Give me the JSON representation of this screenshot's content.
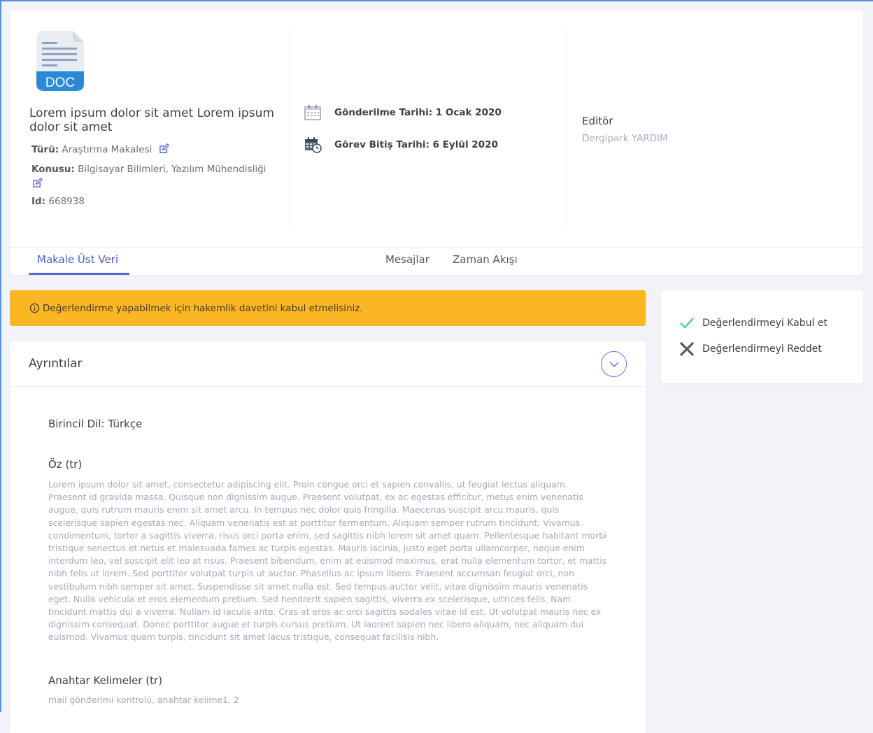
{
  "article": {
    "doc_icon_label": "DOC",
    "title": "Lorem ipsum dolor sit amet Lorem ipsum dolor sit amet",
    "type_label": "Türü:",
    "type_value": "Araştırma Makalesi",
    "subject_label": "Konusu:",
    "subject_value": "Bilgisayar Bilimleri, Yazılım Mühendisliği",
    "id_label": "Id:",
    "id_value": "668938"
  },
  "dates": {
    "submitted": "Gönderilme Tarihi: 1 Ocak 2020",
    "deadline": "Görev Bitiş Tarihi: 6 Eylül 2020"
  },
  "editor": {
    "label": "Editör",
    "name": "Dergipark YARDIM"
  },
  "tabs": [
    {
      "label": "Makale Üst Veri",
      "active": true
    },
    {
      "label": "Mesajlar",
      "active": false
    },
    {
      "label": "Zaman Akışı",
      "active": false
    }
  ],
  "warning": {
    "text": "Değerlendirme yapabilmek için hakemlik davetini kabul etmelisiniz."
  },
  "actions": {
    "accept": "Değerlendirmeyi Kabul et",
    "reject": "Değerlendirmeyi Reddet"
  },
  "details": {
    "title": "Ayrıntılar",
    "primary_language": "Birincil Dil: Türkçe",
    "abstract_heading": "Öz (tr)",
    "abstract_text": "Lorem ipsum dolor sit amet, consectetur adipiscing elit. Proin congue orci et sapien convallis, ut feugiat lectus aliquam. Praesent id gravida massa. Quisque non dignissim augue. Praesent volutpat, ex ac egestas efficitur, metus enim venenatis augue, quis rutrum mauris enim sit amet arcu. In tempus nec dolor quis fringilla. Maecenas suscipit arcu mauris, quis scelerisque sapien egestas nec. Aliquam venenatis est at porttitor fermentum. Aliquam semper rutrum tincidunt. Vivamus condimentum, tortor a sagittis viverra, risus orci porta enim, sed sagittis nibh lorem sit amet quam. Pellentesque habitant morbi tristique senectus et netus et malesuada fames ac turpis egestas. Mauris lacinia, justo eget porta ullamcorper, neque enim interdum leo, vel suscipit elit leo at risus. Praesent bibendum, enim at euismod maximus, erat nulla elementum tortor, et mattis nibh felis ut lorem. Sed porttitor volutpat turpis ut auctor. Phasellus ac ipsum libero. Praesent accumsan feugiat orci, non vestibulum nibh semper sit amet. Suspendisse sit amet nulla est. Sed tempus auctor velit, vitae dignissim mauris venenatis eget. Nulla vehicula et eros elementum pretium. Sed hendrerit sapien sagittis, viverra ex scelerisque, ultrices felis. Nam tincidunt mattis dui a viverra. Nullam id iaculis ante. Cras at eros ac orci sagittis sodales vitae id est. Ut volutpat mauris nec ex dignissim consequat. Donec porttitor augue et turpis cursus pretium. Ut laoreet sapien nec libero aliquam, nec aliquam dui euismod. Vivamus quam turpis, tincidunt sit amet lacus tristique, consequat facilisis nibh.",
    "keywords_heading": "Anahtar Kelimeler (tr)",
    "keywords_text": "mail gönderimi kontrolü, anahtar kelime1, 2"
  },
  "colors": {
    "accent": "#5867dd",
    "warning": "#fbb623",
    "accept_icon": "#34bfa3",
    "reject_icon": "#575962",
    "muted_text": "#a5a8bb"
  },
  "icons": [
    "doc-file-icon",
    "edit-icon",
    "calendar-icon",
    "calendar-clock-icon",
    "info-icon",
    "check-icon",
    "close-icon",
    "chevron-down-icon"
  ]
}
